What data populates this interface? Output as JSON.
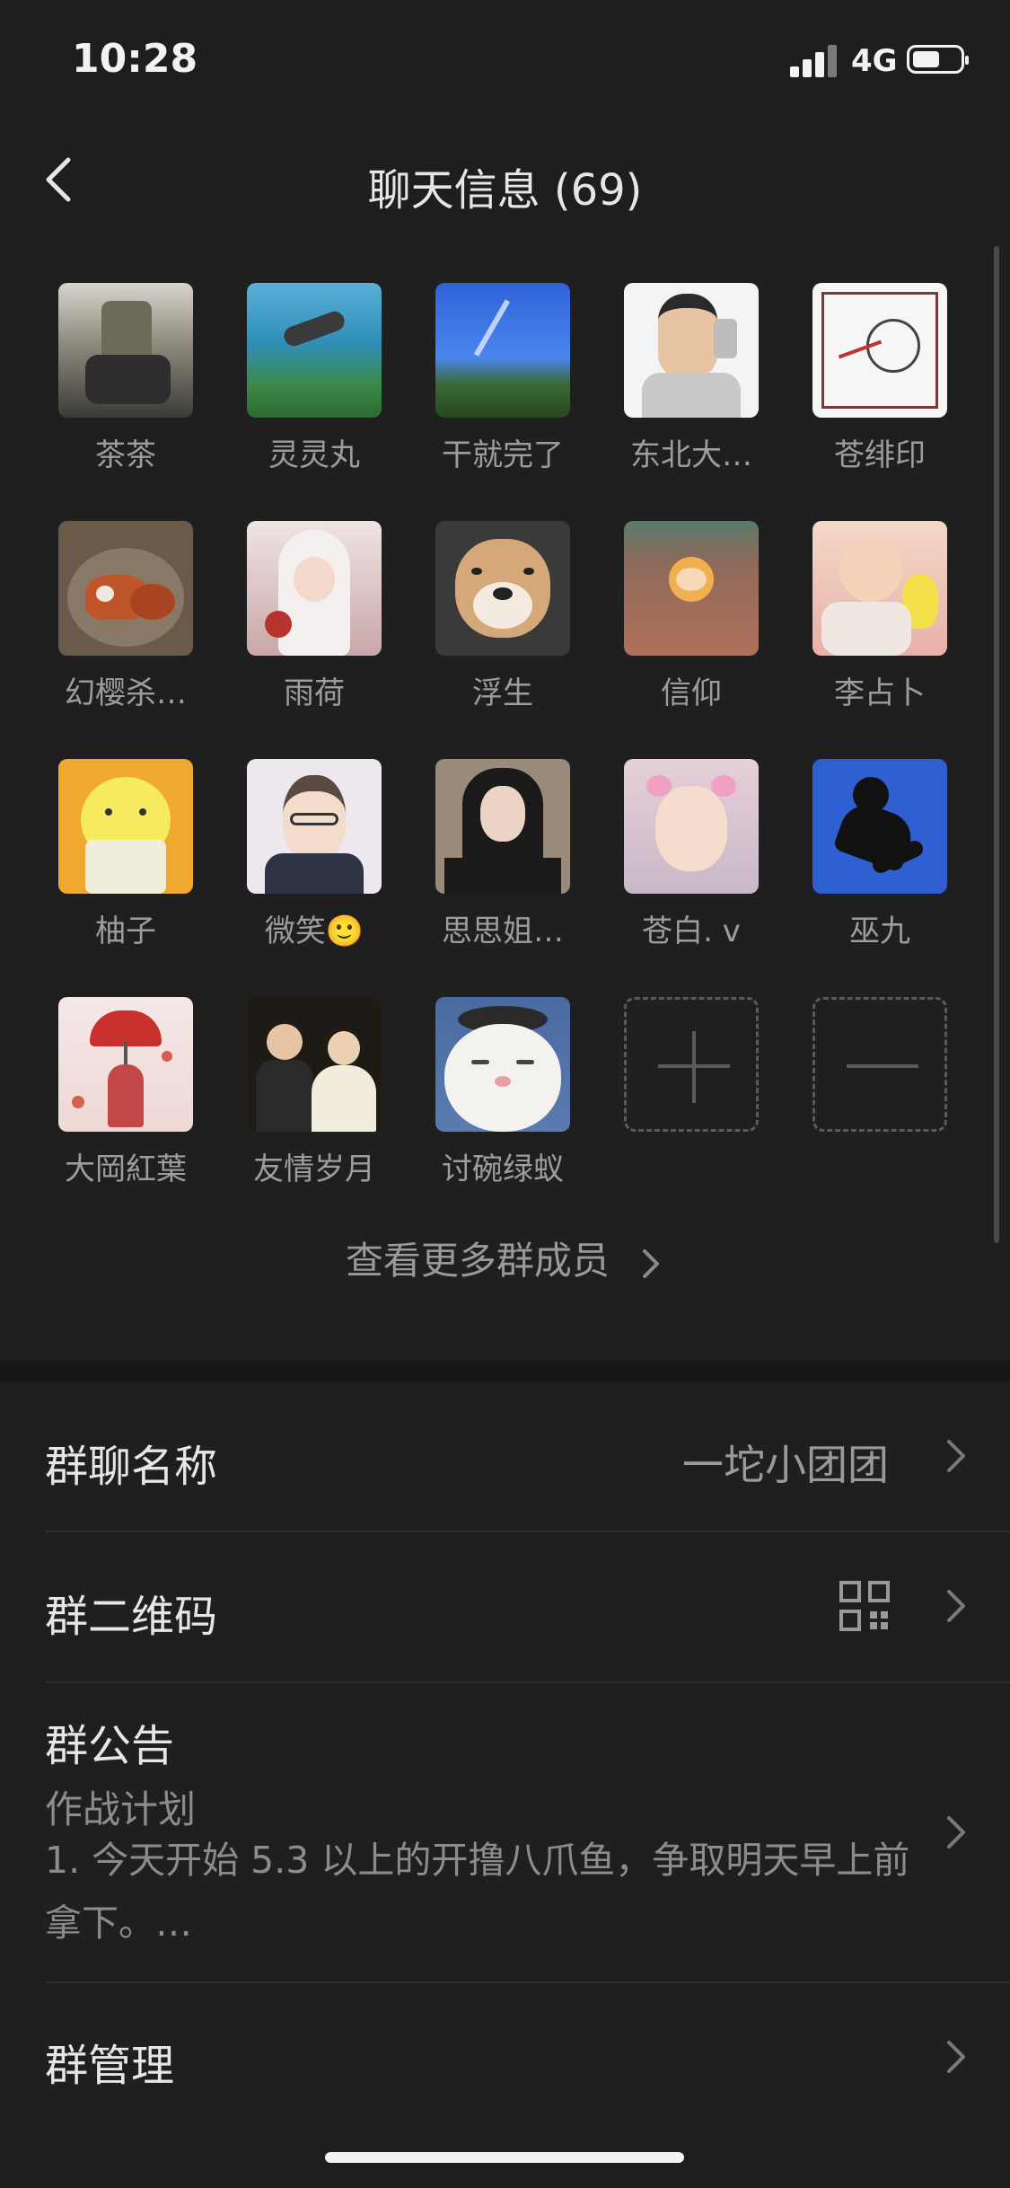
{
  "status_bar": {
    "time": "10:28",
    "network": "4G",
    "battery_level": 0.55
  },
  "nav": {
    "title": "聊天信息 (69)"
  },
  "members": [
    {
      "name": "茶茶",
      "avatar_desc": "person-sitting"
    },
    {
      "name": "灵灵丸",
      "avatar_desc": "underwater-diver"
    },
    {
      "name": "干就完了",
      "avatar_desc": "blue-sky-trees"
    },
    {
      "name": "东北大…",
      "avatar_desc": "cartoon-man-selfie"
    },
    {
      "name": "苍绯印",
      "avatar_desc": "sketch-drawing"
    },
    {
      "name": "幻樱杀…",
      "avatar_desc": "red-panda"
    },
    {
      "name": "雨荷",
      "avatar_desc": "anime-girl-white-hair"
    },
    {
      "name": "浮生",
      "avatar_desc": "shiba-dog"
    },
    {
      "name": "信仰",
      "avatar_desc": "toy-monkey"
    },
    {
      "name": "李占卜",
      "avatar_desc": "baby-photo"
    },
    {
      "name": "柚子",
      "avatar_desc": "yellow-bear"
    },
    {
      "name": "微笑🙂",
      "avatar_desc": "cartoon-boy-glasses"
    },
    {
      "name": "思思姐…",
      "avatar_desc": "woman-portrait"
    },
    {
      "name": "苍白. v",
      "avatar_desc": "little-girl"
    },
    {
      "name": "巫九",
      "avatar_desc": "silhouette-blue"
    },
    {
      "name": "大岡紅葉",
      "avatar_desc": "red-umbrella-girl"
    },
    {
      "name": "友情岁月",
      "avatar_desc": "wedding-couple"
    },
    {
      "name": "讨碗绿蚁",
      "avatar_desc": "smiling-cat"
    }
  ],
  "add_member_icon": "plus-icon",
  "remove_member_icon": "minus-icon",
  "more_members": "查看更多群成员",
  "settings": {
    "group_name_label": "群聊名称",
    "group_name_value": "一坨小团团",
    "qr_label": "群二维码",
    "qr_icon": "qrcode-icon",
    "notice_label": "群公告",
    "notice_title": "作战计划",
    "notice_body": "1.   今天开始 5.3 以上的开撸八爪鱼，争取明天早上前拿下。…",
    "manage_label": "群管理"
  },
  "colors": {
    "background": "#1e1e1e",
    "text": "#e6e6e6",
    "muted": "#9a9a9a",
    "separator": "#2c2c2c"
  }
}
